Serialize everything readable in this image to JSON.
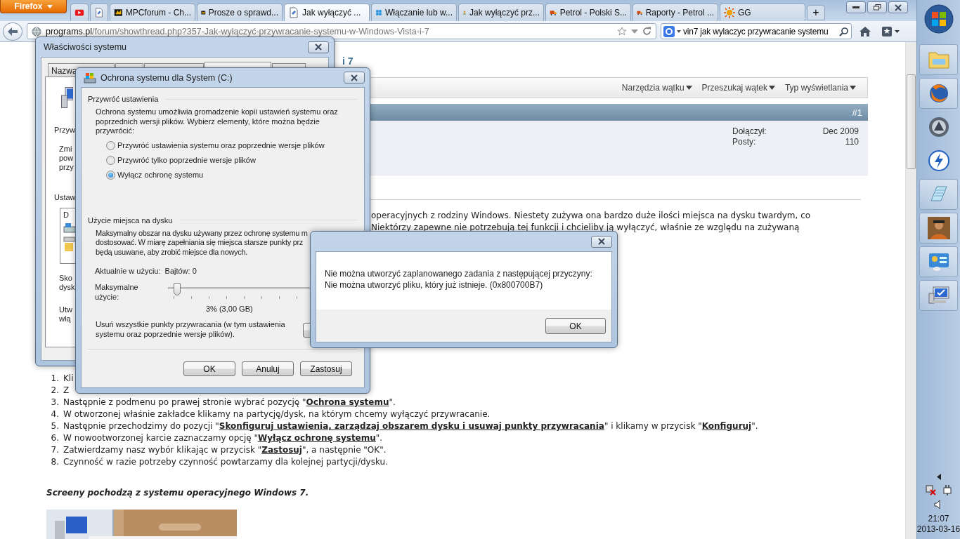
{
  "browser": {
    "menu_button": "Firefox",
    "pinned_tabs": [
      {
        "selected": false
      },
      {
        "selected": false
      }
    ],
    "tabs": [
      {
        "title": "MPCforum - Ch...",
        "selected": false
      },
      {
        "title": "Prosze o sprawd...",
        "selected": false
      },
      {
        "title": "Jak wyłączyć ...",
        "selected": true
      },
      {
        "title": "Włączanie lub w...",
        "selected": false
      },
      {
        "title": "Jak wyłączyć prz...",
        "selected": false
      },
      {
        "title": "Petrol - Polski S...",
        "selected": false
      },
      {
        "title": "Raporty - Petrol ...",
        "selected": false
      },
      {
        "title": "GG",
        "selected": false
      }
    ],
    "new_tab": "+",
    "url": {
      "host": "programs.pl",
      "path": "/forum/showthread.php?357-Jak-wyłączyć-przywracanie-systemu-w-Windows-Vista-i-7"
    },
    "search": {
      "value": "vin7 jak wylaczyc przywracanie systemu"
    }
  },
  "forum": {
    "title_fragment": "i 7",
    "tools": [
      "Narzędzia wątku",
      "Przeszukaj wątek",
      "Typ wyświetlania"
    ],
    "post": {
      "number": "#1",
      "stats": [
        {
          "label": "Dołączył:",
          "value": "Dec 2009"
        },
        {
          "label": "Posty:",
          "value": "110"
        }
      ],
      "intro": [
        "operacyjnych z rodziny Windows. Niestety zużywa ona bardzo duże ilości miejsca na dysku twardym, co",
        "Niektórzy zapewne nie potrzebują tej funkcji i chcieliby ją wyłączyć, właśnie ze względu na zużywaną"
      ],
      "steps": [
        {
          "num": "1.",
          "parts": [
            {
              "kind": "text",
              "text": "Kli"
            }
          ]
        },
        {
          "num": "2.",
          "parts": [
            {
              "kind": "text",
              "text": "Z"
            }
          ]
        },
        {
          "num": "3.",
          "parts": [
            {
              "kind": "text",
              "text": "Następnie z podmenu po prawej stronie wybrać pozycję \""
            },
            {
              "kind": "link",
              "text": "Ochrona systemu"
            },
            {
              "kind": "text",
              "text": "\"."
            }
          ]
        },
        {
          "num": "4.",
          "parts": [
            {
              "kind": "text",
              "text": "W otworzonej właśnie zakładce klikamy na partycję/dysk, na którym chcemy wyłączyć przywracanie."
            }
          ]
        },
        {
          "num": "5.",
          "parts": [
            {
              "kind": "text",
              "text": "Następnie przechodzimy do pozycji \""
            },
            {
              "kind": "link",
              "text": "Skonfiguruj ustawienia, zarządzaj obszarem dysku i usuwaj punkty przywracania"
            },
            {
              "kind": "text",
              "text": "\" i klikamy w przycisk \""
            },
            {
              "kind": "link",
              "text": "Konfiguruj"
            },
            {
              "kind": "text",
              "text": "\"."
            }
          ]
        },
        {
          "num": "6.",
          "parts": [
            {
              "kind": "text",
              "text": "W nowootworzonej karcie zaznaczamy opcję \""
            },
            {
              "kind": "link",
              "text": "Wyłącz ochronę systemu"
            },
            {
              "kind": "text",
              "text": "\"."
            }
          ]
        },
        {
          "num": "7.",
          "parts": [
            {
              "kind": "text",
              "text": "Zatwierdzamy nasz wybór klikając w przycisk \""
            },
            {
              "kind": "link",
              "text": "Zastosuj"
            },
            {
              "kind": "text",
              "text": "\", a następnie \"OK\"."
            }
          ]
        },
        {
          "num": "8.",
          "parts": [
            {
              "kind": "text",
              "text": "Czynność w razie potrzeby czynność powtarzamy dla kolejnej partycji/dysku."
            }
          ]
        }
      ],
      "note": "Screeny pochodzą z systemu operacyjnego Windows 7."
    }
  },
  "system_properties": {
    "title": "Właściwości systemu",
    "tabs": [
      {
        "label": "Nazwa",
        "selected": false
      },
      {
        "selected": false
      },
      {
        "selected": false
      },
      {
        "selected": true
      },
      {
        "selected": false
      }
    ],
    "heading_1": "Przyw",
    "paragraph_1": [
      "Zmi",
      "pow",
      "przy"
    ],
    "heading_2": "Ustaw",
    "list_header": "D",
    "paragraph_2": [
      "Sko",
      "dysk"
    ],
    "paragraph_3": [
      "Utw",
      "włą"
    ]
  },
  "protection_dialog": {
    "title": "Ochrona systemu dla System (C:)",
    "restore_heading": "Przywróć ustawienia",
    "restore_text": "Ochrona systemu umożliwia gromadzenie kopii ustawień systemu oraz poprzednich wersji plików. Wybierz elementy, które można będzie przywrócić:",
    "options": [
      {
        "label": "Przywróć ustawienia systemu oraz poprzednie wersje plików",
        "selected": false
      },
      {
        "label": "Przywróć tylko poprzednie wersje plików",
        "selected": false
      },
      {
        "label": "Wyłącz ochronę systemu",
        "selected": true
      }
    ],
    "disk_heading": "Użycie miejsca na dysku",
    "disk_text": [
      "Maksymalny obszar na dysku używany przez ochronę systemu m",
      "dostosować. W miarę zapełniania się miejsca starsze punkty prz",
      "będą usuwane, aby zrobić miejsce dla nowych."
    ],
    "current_label": "Aktualnie w użyciu:",
    "current_value": "Bajtów: 0",
    "max_label": "Maksymalne użycie:",
    "slider": {
      "level": 0.03
    },
    "slider_reading": "3% (3,00 GB)",
    "delete_text": "Usuń wszystkie punkty przywracania (w tym ustawienia systemu oraz poprzednie wersje plików).",
    "buttons": [
      "OK",
      "Anuluj",
      "Zastosuj"
    ]
  },
  "error_dialog": {
    "message": [
      "Nie można utworzyć zaplanowanego zadania z następującej przyczyny:",
      "Nie można utworzyć pliku, który już istnieje. (0x800700B7)"
    ],
    "button": "OK"
  },
  "taskbar": {
    "items": [
      {
        "running": true
      },
      {
        "running": true
      },
      {
        "running": false
      },
      {
        "running": false
      },
      {
        "running": true
      },
      {
        "running": true
      },
      {
        "running": true
      },
      {
        "running": true
      }
    ],
    "time": "21:07",
    "date": "2013-03-16"
  }
}
